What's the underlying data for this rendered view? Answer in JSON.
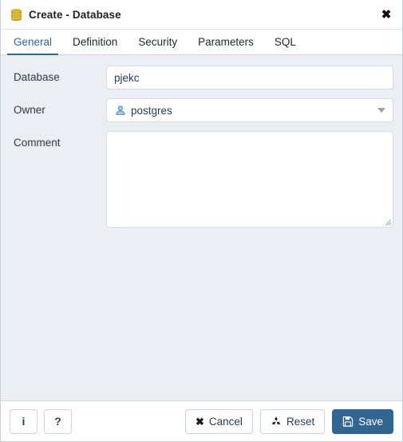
{
  "window": {
    "title": "Create - Database",
    "icon": "database-icon",
    "close_label": "✖"
  },
  "tabs": [
    {
      "label": "General",
      "active": true
    },
    {
      "label": "Definition",
      "active": false
    },
    {
      "label": "Security",
      "active": false
    },
    {
      "label": "Parameters",
      "active": false
    },
    {
      "label": "SQL",
      "active": false
    }
  ],
  "form": {
    "database": {
      "label": "Database",
      "value": "pjekc",
      "placeholder": ""
    },
    "owner": {
      "label": "Owner",
      "value": "postgres",
      "icon": "user-icon",
      "caret": "chevron-down-icon"
    },
    "comment": {
      "label": "Comment",
      "value": "",
      "placeholder": ""
    }
  },
  "footer": {
    "info_label": "i",
    "help_label": "?",
    "cancel_label": "Cancel",
    "reset_label": "Reset",
    "save_label": "Save"
  },
  "colors": {
    "accent": "#326690",
    "background": "#ebeef3",
    "panel": "#ffffff",
    "border": "#d8dde4",
    "db_icon": "#c6a516",
    "user_icon": "#5b9bd5"
  }
}
